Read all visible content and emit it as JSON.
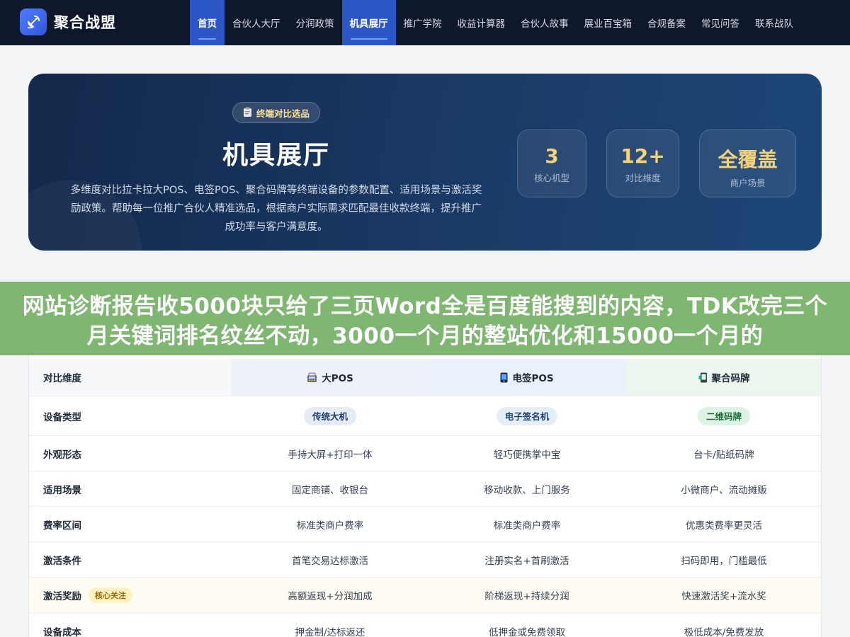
{
  "brand": {
    "name": "聚合战盟",
    "logo_icon": "satellite-dish-icon"
  },
  "nav": {
    "items": [
      {
        "label": "首页",
        "active": true
      },
      {
        "label": "合伙人大厅",
        "active": false
      },
      {
        "label": "分润政策",
        "active": false
      },
      {
        "label": "机具展厅",
        "active": true
      },
      {
        "label": "推广学院",
        "active": false
      },
      {
        "label": "收益计算器",
        "active": false
      },
      {
        "label": "合伙人故事",
        "active": false
      },
      {
        "label": "展业百宝箱",
        "active": false
      },
      {
        "label": "合规备案",
        "active": false
      },
      {
        "label": "常见问答",
        "active": false
      },
      {
        "label": "联系战队",
        "active": false
      }
    ]
  },
  "hero": {
    "tag": "终端对比选品",
    "tag_icon": "clipboard-icon",
    "title": "机具展厅",
    "description": "多维度对比拉卡拉大POS、电签POS、聚合码牌等终端设备的参数配置、适用场景与激活奖励政策。帮助每一位推广合伙人精准选品，根据商户实际需求匹配最佳收款终端，提升推广成功率与客户满意度。",
    "stats": [
      {
        "value": "3",
        "label": "核心机型",
        "color": "#f3d27a"
      },
      {
        "value": "12+",
        "label": "对比维度",
        "color": "#f3d27a"
      },
      {
        "value": "全覆盖",
        "label": "商户场景",
        "color": "#f3d27a"
      }
    ]
  },
  "banner": {
    "text": "网站诊断报告收5000块只给了三页Word全是百度能搜到的内容，TDK改完三个月关键词排名纹丝不动，3000一个月的整站优化和15000一个月的"
  },
  "table": {
    "headers": [
      {
        "label": "对比维度"
      },
      {
        "label": "大POS",
        "icon": "pos-terminal-icon"
      },
      {
        "label": "电签POS",
        "icon": "mobile-pos-icon"
      },
      {
        "label": "聚合码牌",
        "icon": "qr-stand-icon"
      }
    ],
    "rows": [
      {
        "dim": "设备类型",
        "cells": [
          "传统大机",
          "电子签名机",
          "二维码牌"
        ],
        "pill": true
      },
      {
        "dim": "外观形态",
        "cells": [
          "手持大屏+打印一体",
          "轻巧便携掌中宝",
          "台卡/贴纸码牌"
        ]
      },
      {
        "dim": "适用场景",
        "cells": [
          "固定商铺、收银台",
          "移动收款、上门服务",
          "小微商户、流动摊贩"
        ]
      },
      {
        "dim": "费率区间",
        "cells": [
          "标准类商户费率",
          "标准类商户费率",
          "优惠类费率更灵活"
        ]
      },
      {
        "dim": "激活条件",
        "cells": [
          "首笔交易达标激活",
          "注册实名+首刷激活",
          "扫码即用，门槛最低"
        ]
      },
      {
        "dim": "激活奖励",
        "badge": "核心关注",
        "cells": [
          "高额返现+分润加成",
          "阶梯返现+持续分润",
          "快速激活奖+流水奖"
        ],
        "highlight": true
      },
      {
        "dim": "设备成本",
        "cells": [
          "押金制/达标返还",
          "低押金或免费领取",
          "极低成本/免费发放"
        ]
      }
    ]
  }
}
